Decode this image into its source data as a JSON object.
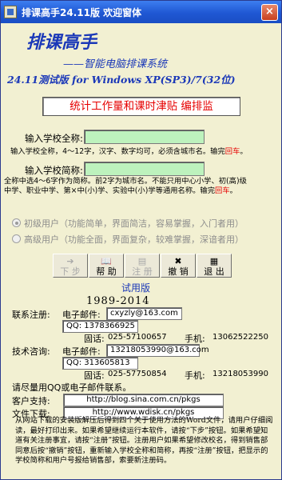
{
  "window": {
    "title": "排课高手24.11版 欢迎窗体",
    "close_glyph": "×"
  },
  "header": {
    "title": "排课高手",
    "subtitle": "——智能电脑排课系统",
    "version": "24.11测试版 for Windows XP(SP3)/7(32位)",
    "banner": "统计工作量和课时津贴  编排监"
  },
  "school_full": {
    "label": "输入学校全称:",
    "value": "",
    "hint": "输入学校全称，4～12字，汉字、数字均可，必须含城市名。输完",
    "hint_key": "回车",
    "hint_end": "。"
  },
  "school_short": {
    "label": "输入学校简称:",
    "value": "",
    "hint_line1": "全称中选4～6字作为简称。前2字为城市名。不能只用中心小学、初(高)级",
    "hint_line2": "中学、职业中学、第×中(小)学、实验中(小)学等通用名称。输完",
    "hint_key": "回车",
    "hint_end": "。"
  },
  "user_level": {
    "options": [
      {
        "label": "初级用户（功能简单，界面简洁，容易掌握，入门者用）",
        "selected": true
      },
      {
        "label": "高级用户（功能全面，界面复杂，较难掌握，深谙者用）",
        "selected": false
      }
    ]
  },
  "toolbar": {
    "buttons": [
      {
        "label": "下 步",
        "icon": "➔",
        "enabled": false
      },
      {
        "label": "帮 助",
        "icon": "📖",
        "enabled": true
      },
      {
        "label": "注 册",
        "icon": "▤",
        "enabled": false
      },
      {
        "label": "撤 销",
        "icon": "✖",
        "enabled": true
      },
      {
        "label": "退 出",
        "icon": "▦",
        "enabled": true
      }
    ]
  },
  "trial_label": "试用版",
  "years": "1989-2014",
  "contacts": {
    "reg_label": "联系注册:",
    "reg_email_label": "电子邮件:",
    "reg_email": "cxyzly@163.com",
    "reg_qq": "QQ: 1378366925",
    "reg_phone_label": "固话:",
    "reg_phone": "025-57100657",
    "reg_mobile_label": "手机:",
    "reg_mobile": "13062522250",
    "tech_label": "技术咨询:",
    "tech_email_label": "电子邮件:",
    "tech_email": "13218053990@163.com",
    "tech_qq": "QQ: 313605813",
    "tech_phone_label": "固话:",
    "tech_phone": "025-57750854",
    "tech_mobile_label": "手机:",
    "tech_mobile": "13218053990",
    "note": "请尽量用QQ或电子邮件联系。"
  },
  "support": {
    "client_label": "客户支持:",
    "client_url": "http://blog.sina.com.cn/pkgs",
    "download_label": "文件下载:",
    "download_url": "http://www.wdisk.cn/pkgs"
  },
  "notes": "从网站下载的安装版解压后得到四个关于使用方法的Word文件，请用户仔细阅读，最好打印出来。如果希望继续运行本软件，请按“下步”按钮。如果希望知道有关注册事宜，请按“注册”按钮。注册用户如果希望修改校名，得到销售部同意后按“撤销”按钮，重新输入学校全称和简称，再按“注册”按钮，把显示的学校简称和用户号报给销售部，索要新注册码。"
}
